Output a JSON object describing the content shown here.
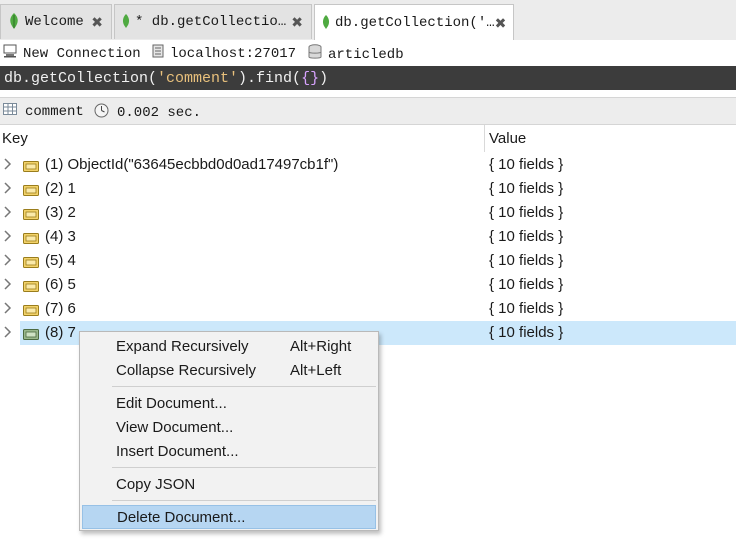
{
  "tabs": [
    {
      "label": "Welcome",
      "close": "✖"
    },
    {
      "label": "* db.getCollectio…",
      "close": "✖"
    },
    {
      "label": "db.getCollection('…",
      "close": "✖"
    }
  ],
  "connection": {
    "name": "New Connection",
    "host": "localhost:27017",
    "database": "articledb"
  },
  "query": {
    "prefix": "db.getCollection(",
    "arg": "'comment'",
    "middle": ").find(",
    "braces": "{}",
    "suffix": ")"
  },
  "results": {
    "collection": "comment",
    "time": "0.002 sec."
  },
  "tree": {
    "key_header": "Key",
    "value_header": "Value",
    "rows": [
      {
        "key": "(1) ObjectId(\"63645ecbbd0d0ad17497cb1f\")",
        "value": "{ 10 fields }"
      },
      {
        "key": "(2) 1",
        "value": "{ 10 fields }"
      },
      {
        "key": "(3) 2",
        "value": "{ 10 fields }"
      },
      {
        "key": "(4) 3",
        "value": "{ 10 fields }"
      },
      {
        "key": "(5) 4",
        "value": "{ 10 fields }"
      },
      {
        "key": "(6) 5",
        "value": "{ 10 fields }"
      },
      {
        "key": "(7) 6",
        "value": "{ 10 fields }"
      },
      {
        "key": "(8) 7",
        "value": "{ 10 fields }"
      }
    ]
  },
  "context_menu": {
    "expand": {
      "label": "Expand Recursively",
      "shortcut": "Alt+Right"
    },
    "collapse": {
      "label": "Collapse Recursively",
      "shortcut": "Alt+Left"
    },
    "edit": "Edit Document...",
    "view": "View Document...",
    "insert": "Insert Document...",
    "copy_json": "Copy JSON",
    "delete": "Delete Document..."
  },
  "colors": {
    "accent_green": "#4faa41",
    "query_bg": "#3c3c3c",
    "query_string": "#e8c07c",
    "query_braces": "#d8a3ff",
    "selection": "#cce8fb",
    "menu_highlight": "#b6d6f2"
  }
}
